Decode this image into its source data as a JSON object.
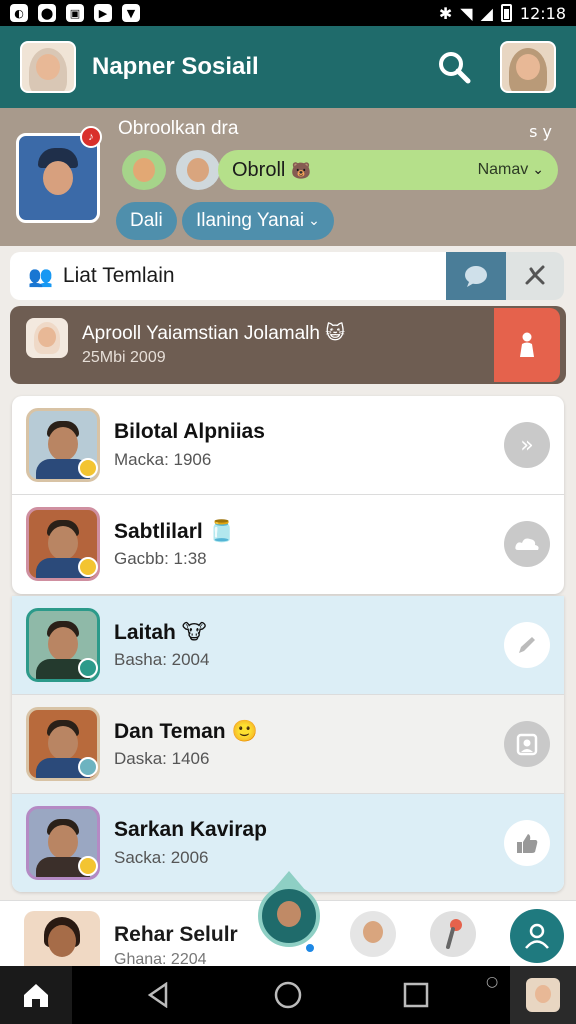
{
  "status_bar": {
    "left_icons": [
      "app-icon-1",
      "app-icon-2",
      "app-icon-3",
      "app-icon-4",
      "shield-icon"
    ],
    "time": "12:18"
  },
  "app_bar": {
    "title": "Napner Sosiail",
    "search_icon": "search-icon"
  },
  "profile": {
    "name": "Obroolkan dra",
    "extra": "s y",
    "chat_pill": {
      "label": "Obroll",
      "emoji": "🐻",
      "right_label": "Namav",
      "chevron": "⌄"
    },
    "chips": [
      "Dali",
      "Ilaning Yanai"
    ]
  },
  "friends_bar": {
    "label": "Liat Temlain"
  },
  "banner": {
    "title": "Aprooll Yaiamstian Jolamalh",
    "emoji": "😺",
    "date": "25Mbi 2009"
  },
  "contacts": [
    {
      "name": "Bilotal Alpniias",
      "sub": "Macka: 1906",
      "emoji": ""
    },
    {
      "name": "Sabtlilarl",
      "sub": "Gacbb: 1:38",
      "emoji": "🫙"
    },
    {
      "name": "Laitah",
      "sub": "Basha: 2004",
      "emoji": "🐮"
    },
    {
      "name": "Dan Teman",
      "sub": "Daska: 1406",
      "emoji": "🙂"
    },
    {
      "name": "Sarkan Kavirap",
      "sub": "Sacka: 2006",
      "emoji": ""
    }
  ],
  "tray": {
    "name": "Rehar Selulr",
    "sub": "Ghana: 2204"
  },
  "colors": {
    "app_bar": "#1f6b6b",
    "chat_pill": "#b5e08a",
    "chip": "#4f8fac",
    "banner": "#6e5d52",
    "banner_action": "#e5624c",
    "highlight_row": "#dceef6"
  }
}
